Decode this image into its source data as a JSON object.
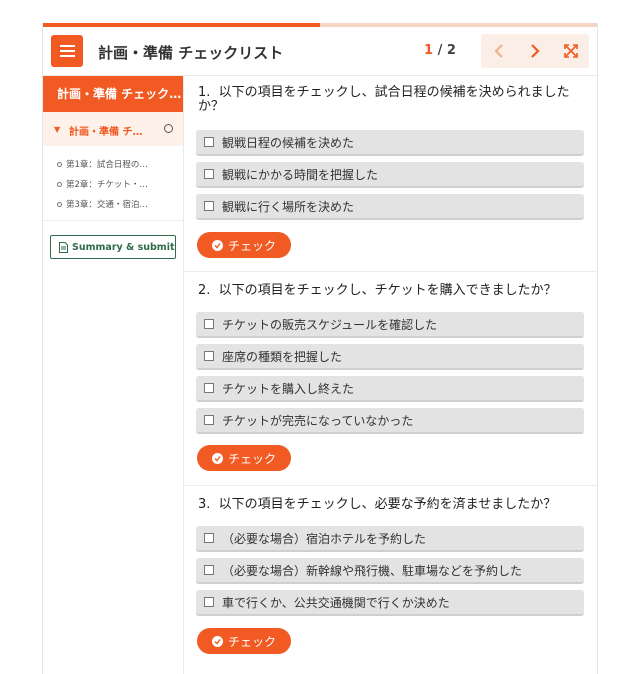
{
  "progress": {
    "fraction": 0.5
  },
  "header": {
    "title": "計画・準備 チェックリスト",
    "page_current": "1",
    "page_sep": " / ",
    "page_total": "2"
  },
  "sidebar": {
    "head": "計画・準備 チェックリスト",
    "section": "計画・準備 チェックリスト",
    "chapters": [
      "第1章：試合日程の…",
      "第2章：チケット・…",
      "第3章：交通・宿泊…"
    ],
    "summary_label": "Summary & submit"
  },
  "questions": [
    {
      "number": "1.",
      "text": "以下の項目をチェックし、試合日程の候補を決められましたか？",
      "options": [
        "観戦日程の候補を決めた",
        "観戦にかかる時間を把握した",
        "観戦に行く場所を決めた"
      ],
      "button": "チェック"
    },
    {
      "number": "2.",
      "text": "以下の項目をチェックし、チケットを購入できましたか？",
      "options": [
        "チケットの販売スケジュールを確認した",
        "座席の種類を把握した",
        "チケットを購入し終えた",
        "チケットが完売になっていなかった"
      ],
      "button": "チェック"
    },
    {
      "number": "3.",
      "text": "以下の項目をチェックし、必要な予約を済ませましたか？",
      "options": [
        "（必要な場合）宿泊ホテルを予約した",
        "（必要な場合）新幹線や飛行機、駐車場などを予約した",
        "車で行くか、公共交通機関で行くか決めた"
      ],
      "button": "チェック"
    }
  ],
  "colors": {
    "accent": "#f15a22",
    "summary": "#2f6b4b"
  },
  "icons": {
    "menu": "hamburger-icon",
    "prev": "chevron-left-icon",
    "next": "chevron-right-icon",
    "fullscreen": "expand-icon",
    "check": "check-circle-icon",
    "doc": "document-icon"
  }
}
